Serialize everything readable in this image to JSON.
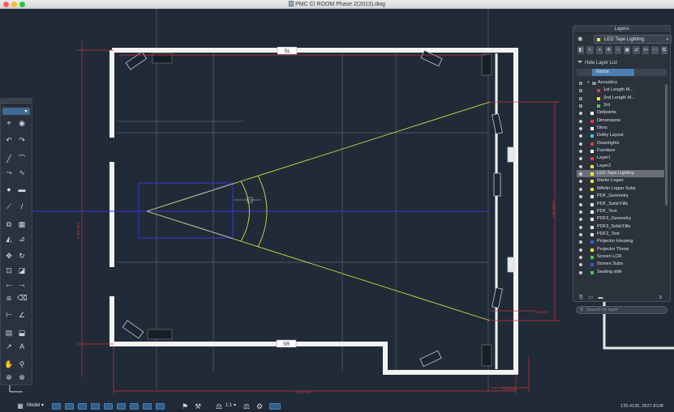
{
  "window": {
    "title": "PMC CI ROOM Phase 2(2013).dwg"
  },
  "drawing": {
    "labels": {
      "top_speaker": "SL",
      "bottom_speaker": "SR"
    },
    "dimensions": {
      "bottom_overall": "5,240 mm",
      "bottom_small": "800 mm",
      "left_height": "4,000 mm",
      "right_height": "3,950 mm",
      "right_small": "125 mm"
    }
  },
  "layers_panel": {
    "title": "Layers",
    "current_layer": "LED Tape Lighting",
    "current_color": "#f4e62b",
    "hide_list_label": "Hide Layer List",
    "column_header": "Name",
    "search_placeholder": "Search for layer",
    "layers": [
      {
        "name": "Acoustics",
        "color": "#8d97a3",
        "folder": true,
        "eye": false
      },
      {
        "name": "1st Length M...",
        "color": "#e03a3a",
        "eye": false
      },
      {
        "name": "2nd Length M...",
        "color": "#f4e62b",
        "eye": false
      },
      {
        "name": "3rd",
        "color": "#37d24b",
        "eye": false
      },
      {
        "name": "Defpoints",
        "color": "#ffffff",
        "eye": true
      },
      {
        "name": "Dimensions",
        "color": "#e03a3a",
        "eye": true
      },
      {
        "name": "Dims",
        "color": "#ffffff",
        "eye": true
      },
      {
        "name": "Dolby Layout",
        "color": "#37c7e8",
        "eye": true
      },
      {
        "name": "Downlights",
        "color": "#e03a3a",
        "eye": true
      },
      {
        "name": "Furniture",
        "color": "#ffffff",
        "eye": true
      },
      {
        "name": "Layer1",
        "color": "#e03a3a",
        "eye": true
      },
      {
        "name": "Layer2",
        "color": "#f4e62b",
        "eye": true
      },
      {
        "name": "LED Tape Lighting",
        "color": "#f4e62b",
        "eye": true,
        "selected": true
      },
      {
        "name": "Martin Logan",
        "color": "#f4e62b",
        "eye": true
      },
      {
        "name": "MArtin Logan Subs",
        "color": "#f4e62b",
        "eye": true
      },
      {
        "name": "PDF_Geometry",
        "color": "#ffffff",
        "eye": true
      },
      {
        "name": "PDF_Solid Fills",
        "color": "#ffffff",
        "eye": true
      },
      {
        "name": "PDF_Text",
        "color": "#ffffff",
        "eye": true
      },
      {
        "name": "PDF2_Geometry",
        "color": "#ffffff",
        "eye": true
      },
      {
        "name": "PDF2_Solid Fills",
        "color": "#ffffff",
        "eye": true
      },
      {
        "name": "PDF2_Text",
        "color": "#ffffff",
        "eye": true
      },
      {
        "name": "Projector Housing",
        "color": "#2f5fe0",
        "eye": true
      },
      {
        "name": "Projector Throw",
        "color": "#f4e62b",
        "eye": true
      },
      {
        "name": "Screen LCR",
        "color": "#37d24b",
        "eye": true
      },
      {
        "name": "Screen Subs",
        "color": "#2f5fe0",
        "eye": true
      },
      {
        "name": "Seating side",
        "color": "#37d24b",
        "eye": true
      }
    ]
  },
  "statusbar": {
    "model_label": "Model",
    "scale_label": "1:1"
  },
  "coordinates": "135.4195, 9527.8108"
}
